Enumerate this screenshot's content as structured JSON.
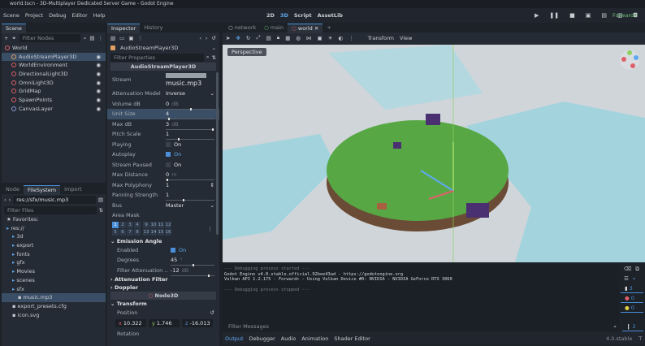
{
  "window": {
    "title": "world.tscn - 3D-Multiplayer Dedicated Server Game - Godot Engine"
  },
  "menu": [
    "Scene",
    "Project",
    "Debug",
    "Editor",
    "Help"
  ],
  "main_screens": [
    "2D",
    "3D",
    "Script",
    "AssetLib"
  ],
  "renderer": "Forward+",
  "scene_dock": {
    "tab": "Scene",
    "filter_placeholder": "Filter Nodes",
    "nodes": [
      {
        "label": "World",
        "color": "#e0606a",
        "indent": 0
      },
      {
        "label": "AudioStreamPlayer3D",
        "color": "#e0a060",
        "indent": 1,
        "selected": true
      },
      {
        "label": "WorldEnvironment",
        "color": "#e0606a",
        "indent": 1
      },
      {
        "label": "DirectionalLight3D",
        "color": "#e0606a",
        "indent": 1
      },
      {
        "label": "OmniLight3D",
        "color": "#e0606a",
        "indent": 1
      },
      {
        "label": "GridMap",
        "color": "#e0606a",
        "indent": 1
      },
      {
        "label": "SpawnPoints",
        "color": "#e0606a",
        "indent": 1
      },
      {
        "label": "CanvasLayer",
        "color": "#8a9cd8",
        "indent": 1
      }
    ]
  },
  "filesystem_dock": {
    "tabs": [
      "Node",
      "FileSystem",
      "Import"
    ],
    "active_tab": "FileSystem",
    "path": "res://sfx/music.mp3",
    "filter_placeholder": "Filter Files",
    "items": [
      {
        "label": "Favorites:",
        "indent": 0,
        "type": "star"
      },
      {
        "label": "res://",
        "indent": 0,
        "type": "folder"
      },
      {
        "label": "3d",
        "indent": 1,
        "type": "folder"
      },
      {
        "label": "export",
        "indent": 1,
        "type": "folder"
      },
      {
        "label": "fonts",
        "indent": 1,
        "type": "folder"
      },
      {
        "label": "gfx",
        "indent": 1,
        "type": "folder"
      },
      {
        "label": "Movies",
        "indent": 1,
        "type": "folder"
      },
      {
        "label": "scenes",
        "indent": 1,
        "type": "folder"
      },
      {
        "label": "sfx",
        "indent": 1,
        "type": "folder"
      },
      {
        "label": "music.mp3",
        "indent": 2,
        "type": "file",
        "selected": true
      },
      {
        "label": "export_presets.cfg",
        "indent": 1,
        "type": "file"
      },
      {
        "label": "icon.svg",
        "indent": 1,
        "type": "file"
      }
    ]
  },
  "inspector": {
    "tabs": [
      "Inspector",
      "History"
    ],
    "object": "AudioStreamPlayer3D",
    "filter_placeholder": "Filter Properties",
    "class_header": "AudioStreamPlayer3D",
    "stream_label": "Stream",
    "stream_value": "music.mp3",
    "props": [
      {
        "k": "Attenuation Model",
        "v": "Inverse",
        "type": "enum"
      },
      {
        "k": "Volume dB",
        "v": "0",
        "unit": "dB",
        "type": "slider",
        "fill": 0.5
      },
      {
        "k": "Unit Size",
        "v": "4",
        "type": "slider",
        "fill": 0.05,
        "selected": true
      },
      {
        "k": "Max dB",
        "v": "3",
        "unit": "dB",
        "type": "slider",
        "fill": 0.95
      },
      {
        "k": "Pitch Scale",
        "v": "1",
        "type": "slider",
        "fill": 0.25
      },
      {
        "k": "Playing",
        "v": "On",
        "type": "check",
        "checked": false
      },
      {
        "k": "Autoplay",
        "v": "On",
        "type": "check",
        "checked": true
      },
      {
        "k": "Stream Paused",
        "v": "On",
        "type": "check",
        "checked": false
      },
      {
        "k": "Max Distance",
        "v": "0",
        "unit": "m",
        "type": "slider",
        "fill": 0.01
      },
      {
        "k": "Max Polyphony",
        "v": "1",
        "type": "spin"
      },
      {
        "k": "Panning Strength",
        "v": "1",
        "type": "slider",
        "fill": 0.35
      },
      {
        "k": "Bus",
        "v": "Master",
        "type": "enum"
      }
    ],
    "area_mask_label": "Area Mask",
    "area_mask": [
      "1",
      "2",
      "3",
      "4",
      "9",
      "10",
      "11",
      "12",
      "5",
      "6",
      "7",
      "8",
      "13",
      "14",
      "15",
      "16"
    ],
    "emission_section": "Emission Angle",
    "emission": [
      {
        "k": "Enabled",
        "v": "On",
        "type": "check",
        "checked": true
      },
      {
        "k": "Degrees",
        "v": "45",
        "unit": "°",
        "type": "slider",
        "fill": 0.5
      },
      {
        "k": "Filter Attenuation ...",
        "v": "-12",
        "unit": "dB",
        "type": "slider",
        "fill": 0.85
      }
    ],
    "collapsed_sections": [
      "Attenuation Filter",
      "Doppler"
    ],
    "node3d_header": "Node3D",
    "transform_section": "Transform",
    "position_label": "Position",
    "position": {
      "x": "10.322",
      "y": "1.746",
      "z": "-16.013",
      "unit": "m"
    },
    "rotation_label": "Rotation"
  },
  "viewport": {
    "scene_tabs": [
      {
        "label": "network",
        "color": "#c9cdd3"
      },
      {
        "label": "main",
        "color": "#6cc070"
      },
      {
        "label": "world",
        "color": "#e0606a",
        "active": true
      }
    ],
    "menus": [
      "Transform",
      "View"
    ],
    "perspective_label": "Perspective"
  },
  "output": {
    "lines": [
      {
        "text": "--- Debugging process started ---",
        "dim": true
      },
      {
        "text": "Godot Engine v4.0.stable.official.92bee43ad - https://godotengine.org",
        "dim": false
      },
      {
        "text": "Vulkan API 1.2.175 - Forward+ - Using Vulkan Device #0: NVIDIA - NVIDIA GeForce RTX 3060",
        "dim": false
      },
      {
        "text": "",
        "dim": true
      },
      {
        "text": "--- Debugging process stopped ---",
        "dim": true
      }
    ],
    "filter_placeholder": "Filter Messages",
    "counts": {
      "messages": "3",
      "errors": "0",
      "warnings": "0",
      "editor": "2"
    }
  },
  "bottom_tabs": [
    "Output",
    "Debugger",
    "Audio",
    "Animation",
    "Shader Editor"
  ],
  "version": "4.0.stable"
}
